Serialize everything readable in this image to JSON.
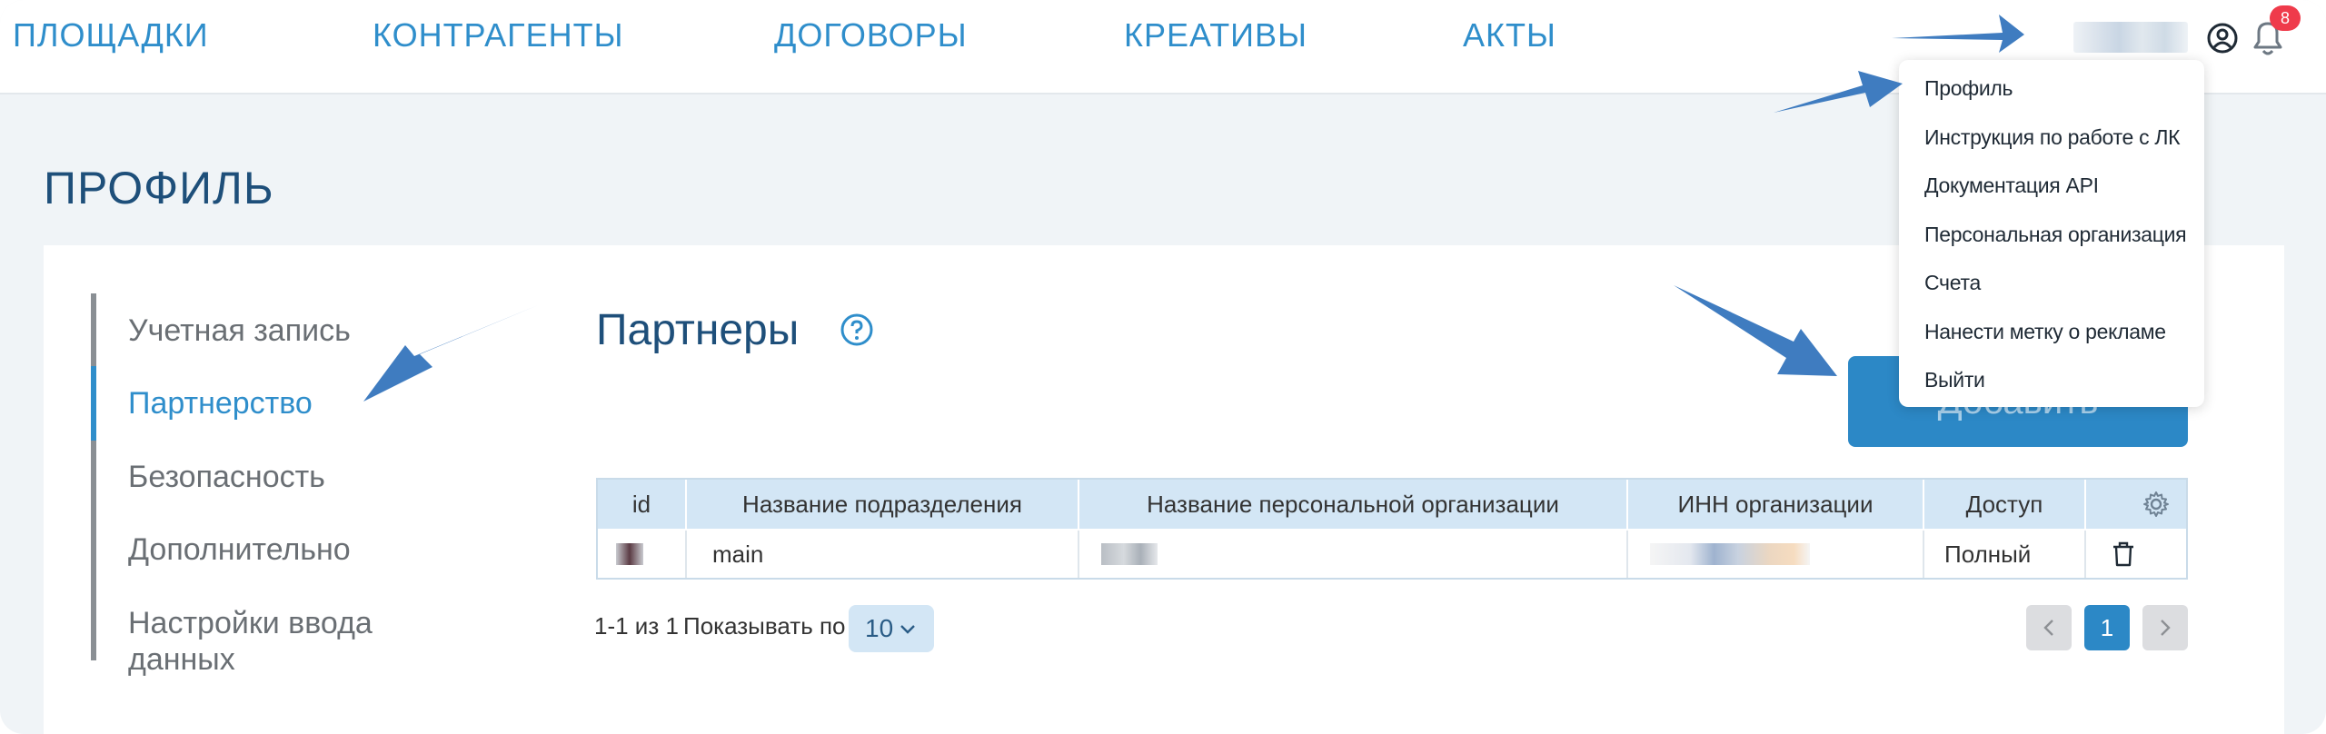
{
  "nav": {
    "items": [
      {
        "label": "ПЛОЩАДКИ"
      },
      {
        "label": "КОНТРАГЕНТЫ"
      },
      {
        "label": "ДОГОВОРЫ"
      },
      {
        "label": "КРЕАТИВЫ"
      },
      {
        "label": "АКТЫ"
      }
    ],
    "notification_count": "8"
  },
  "page": {
    "title": "ПРОФИЛЬ"
  },
  "sidebar": {
    "items": [
      {
        "label": "Учетная запись"
      },
      {
        "label": "Партнерство"
      },
      {
        "label": "Безопасность"
      },
      {
        "label": "Дополнительно"
      },
      {
        "label": "Настройки ввода"
      },
      {
        "label": "данных"
      }
    ]
  },
  "section": {
    "title": "Партнеры",
    "add_button_label": "Добавить"
  },
  "table": {
    "columns": [
      "id",
      "Название подразделения",
      "Название персональной организации",
      "ИНН организации",
      "Доступ"
    ],
    "rows": [
      {
        "subdivision": "main",
        "access": "Полный"
      }
    ]
  },
  "pagination": {
    "range_text": "1-1 из 1",
    "show_label": "Показывать по",
    "page_size": "10",
    "current_page": "1"
  },
  "dropdown": {
    "items": [
      {
        "label": "Профиль"
      },
      {
        "label": "Инструкция по работе с ЛК"
      },
      {
        "label": "Документация API"
      },
      {
        "label": "Персональная организация"
      },
      {
        "label": "Счета"
      },
      {
        "label": "Нанести метку о рекламе"
      },
      {
        "label": "Выйти"
      }
    ]
  },
  "colors": {
    "accent": "#2f8ecb",
    "title": "#1e4f7a",
    "table_header": "#d3e6f5",
    "arrow": "#3f7cc0",
    "badge": "#ef3b4b"
  }
}
